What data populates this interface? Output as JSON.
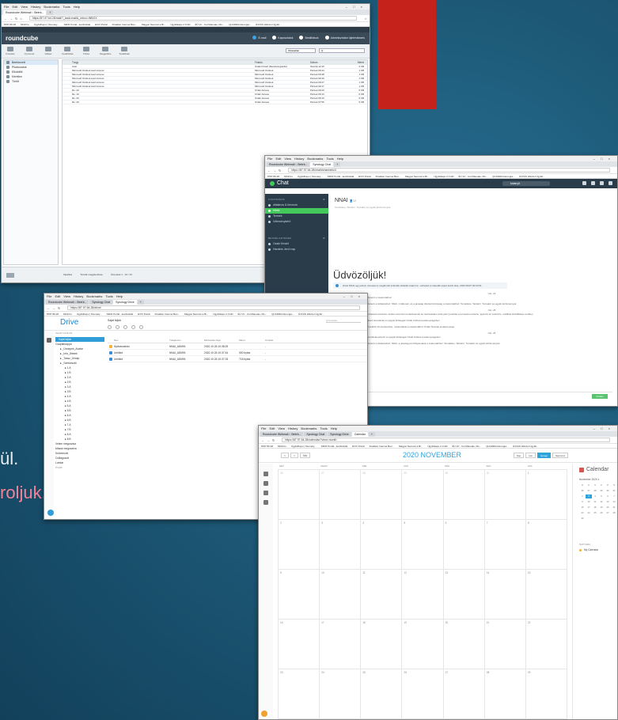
{
  "slide": {
    "line1": "ül.",
    "line2": "roljuk, ingyenes)"
  },
  "colors": {
    "accent_red": "#c4221b",
    "chat_green": "#44c85c",
    "drive_blue": "#2f9ed8",
    "calendar_blue": "#2fa3dc"
  },
  "common": {
    "menu": [
      "File",
      "Edit",
      "View",
      "History",
      "Bookmarks",
      "Tools",
      "Help"
    ],
    "bookmarks": [
      "8787.86.28",
      "MOZ.hu",
      "ÜgyfélKapu | Személy...",
      "SZDF Portál - kezdőoldal",
      "EVIV Portál",
      "Dnskiker Internet Ban...",
      "Magyar Nemzeti a Bi...",
      "Ügyfélkapu 2.0 HD",
      "ÉÜ Vír - Cel Manuale, Mo...",
      "QUADRA4 Energia...",
      "ÉJVÁS Hitiszet Ügyfél..."
    ]
  },
  "roundcube": {
    "tabs": [
      "Roundcube Webmail :: Beérk...",
      "+"
    ],
    "url": "https://87.97.64.28/mail/?_task=mail&_mbox=INBOX",
    "brand": "roundcube",
    "header_items": [
      "E-mail",
      "Kapcsolatok",
      "Beállítások",
      "Adminisztrátor kijelentkezés"
    ],
    "toolbar": [
      "Frissítés",
      "Új üzenet",
      "Válasz",
      "Továbbítás",
      "Törlés",
      "Megjelölés",
      "Továbbiak"
    ],
    "search_scope": "Olvasatlan",
    "search_placeholder": "Q",
    "folders": [
      "Beérkezett",
      "Piszkozatok",
      "Elküldött",
      "Kéretlen",
      "Törölt"
    ],
    "list_headers": {
      "subject": "Tárgy",
      "from": "Feladó",
      "date": "Dátum",
      "size": "Méret"
    },
    "rows": [
      {
        "subject": "Auto",
        "from": "Ozaki Kristóf (Rendszergazda)",
        "date": "Szerda 12:15",
        "size": "2 KB"
      },
      {
        "subject": "Microsoft Outlook teszt-üzenet",
        "from": "Microsoft Outlook",
        "date": "Péntek 09:44",
        "size": "1 KB"
      },
      {
        "subject": "Microsoft Outlook teszt-üzenet",
        "from": "Microsoft Outlook",
        "date": "Péntek 09:38",
        "size": "1 KB"
      },
      {
        "subject": "Microsoft Outlook teszt-üzenet",
        "from": "Microsoft Outlook",
        "date": "Péntek 09:30",
        "size": "1 KB"
      },
      {
        "subject": "Microsoft Outlook teszt-üzenet",
        "from": "Microsoft Outlook",
        "date": "Péntek 09:27",
        "size": "1 KB"
      },
      {
        "subject": "Microsoft Outlook teszt-üzenet",
        "from": "Microsoft Outlook",
        "date": "Péntek 09:17",
        "size": "1 KB"
      },
      {
        "subject": "Re: 20",
        "from": "Ozaki Jenese",
        "date": "Péntek 09:20",
        "size": "6 KB"
      },
      {
        "subject": "Re: 10",
        "from": "Ozaki Jenese",
        "date": "Péntek 09:13",
        "size": "6 KB"
      },
      {
        "subject": "Re: 20",
        "from": "Ozaki Jenese",
        "date": "Péntek 09:10",
        "size": "6 KB"
      },
      {
        "subject": "Re: 20",
        "from": "Ozaki Jenese",
        "date": "Péntek 07:56",
        "size": "6 KB"
      }
    ],
    "footer": [
      "Kijelölés",
      "Témák megjelenítése",
      "Üzenetek 1 - 10 / 10"
    ]
  },
  "chat": {
    "tabs": [
      "Roundcube Webmail :: Beérk...",
      "Synology Chat",
      "+"
    ],
    "url": "https://87.97.64.28/chat/#channels/4",
    "brand": "Chat",
    "search": "kalanyit",
    "sections": {
      "channels": "CSATORNÁK",
      "direct": "BESZÉLGETÉSEK"
    },
    "channels": [
      "általános & fórumok",
      "Hírek",
      "Termék",
      "Véleménykérő"
    ],
    "directs": [
      "Ozaki Kristóf",
      "Haralnis Jenő nap"
    ],
    "selected_channel": "Hírek",
    "channel_title": "NNAI",
    "channel_members": "13",
    "channel_sub": "Tematikus, Tartalmi, Témakör és egyéb közlemények",
    "welcome": "Üdvözöljük!",
    "notice": "Hírek NNAI egy jelzett, üzenetet a megkímélt szándék előtelélt csatorna - elolvasd a második napot kezdt ütés, 2020 09/27 00:10:51",
    "days": [
      "Okt. 23",
      "Okt. 28",
      "Okt. 28"
    ],
    "messages": [
      "allszenti a csatornákhoz",
      "allszenti a küldetéshez: NNAI, nzddenek, és a javaság döntséi közösség a csatornákhoz: Tematikus, Tartalmi, Témakör és egyéb közlemények",
      "a kötelező értesítés minden szerzési rendeléseinek és részvételére amik pénz jóváírás a termelési esztertu, igazolni az eszközre, szállítás kiszállítása rendben",
      "Állami beruházás a nyagoti költségek Ozaki Andréa tevékenységében",
      "a korábbi 19 szerkesztés, módosításai a csatornákhoz Ozaki Terések tevékenysége",
      "beruházás-érkező a nyagoti költségek Ozaki Andréa tevékenységében",
      "allszenti a küldetéshez: NNAI, a javaság pénzfolyamatok a csatornákhoz: Tematikus, Tartalmi, Témakör és egyéb közlemények"
    ],
    "send": "Küldés"
  },
  "drive": {
    "tabs": [
      "Roundcube Webmail :: Beérk...",
      "Synology Chat",
      "Synology Drive",
      "+"
    ],
    "url": "https://87.97.64.28/drive/",
    "brand": "Drive",
    "breadcrumb": "Saját fájlok",
    "search": "Q Keresés",
    "section": "SAJÁT FÁJLOK",
    "tree": [
      {
        "label": "Saját fájlok",
        "level": 0,
        "sel": true
      },
      {
        "label": "Csapatmappa",
        "level": 0
      },
      {
        "label": "_Ünnepek_Avatar",
        "level": 1
      },
      {
        "label": "_Info_Ülések",
        "level": 1
      },
      {
        "label": "_Tassz_Ünnép",
        "level": 1
      },
      {
        "label": "_Szerkesztő",
        "level": 1
      },
      {
        "label": "1.A",
        "level": 2
      },
      {
        "label": "1.B",
        "level": 2
      },
      {
        "label": "2.A",
        "level": 2
      },
      {
        "label": "2.B",
        "level": 2
      },
      {
        "label": "3.A",
        "level": 2
      },
      {
        "label": "3.B",
        "level": 2
      },
      {
        "label": "4.A",
        "level": 2
      },
      {
        "label": "4.B",
        "level": 2
      },
      {
        "label": "5.A",
        "level": 2
      },
      {
        "label": "5.B",
        "level": 2
      },
      {
        "label": "6.A",
        "level": 2
      },
      {
        "label": "6.B",
        "level": 2
      },
      {
        "label": "7.A",
        "level": 2
      },
      {
        "label": "7.B",
        "level": 2
      },
      {
        "label": "8.A",
        "level": 2
      },
      {
        "label": "8.B",
        "level": 2
      },
      {
        "label": "Velem megosztva",
        "level": 0
      },
      {
        "label": "Mások megosztva",
        "level": 0
      },
      {
        "label": "Kedvencek",
        "level": 0
      },
      {
        "label": "Csillagozott",
        "level": 0
      },
      {
        "label": "Lomtár",
        "level": 0
      }
    ],
    "quota": "Kvóta",
    "headers": {
      "name": "Név",
      "owner": "Tulajdonos",
      "modified": "Módosítás ideje",
      "size": "Méret",
      "desc": "Címkék"
    },
    "rows": [
      {
        "name": "Nyilvánosfoto",
        "owner": "NNAI_ADMIN",
        "modified": "2020.10.26 10:38:29",
        "size": "",
        "desc": "-",
        "folder": true
      },
      {
        "name": "Untitled",
        "owner": "NNAI_ADMIN",
        "modified": "2020.10.26 10:37:44",
        "size": "500 bytes",
        "desc": "-",
        "folder": false
      },
      {
        "name": "Untitled",
        "owner": "NNAI_ADMIN",
        "modified": "2020.10.26 10:37:33",
        "size": "718 bytes",
        "desc": "-",
        "folder": false
      }
    ]
  },
  "calendar": {
    "tabs": [
      "Roundcube Webmail :: Beérk...",
      "Synology Chat",
      "Synology Drive",
      "Calendar",
      "+"
    ],
    "url": "https://87.97.64.28/calendar/?view=month",
    "title": "2020 NOVEMBER",
    "nav": [
      "<",
      ">",
      "Ma"
    ],
    "views": [
      "Nap",
      "Hét",
      "Hónap",
      "Napirend"
    ],
    "active_view": "Hónap",
    "dow": [
      "HÉT",
      "KEDD",
      "SZE",
      "CSÜ",
      "PÉN",
      "SZO",
      "VAS"
    ],
    "weeks": [
      [
        "26",
        "27",
        "28",
        "29",
        "30",
        "31",
        "1"
      ],
      [
        "2",
        "3",
        "4",
        "5",
        "6",
        "7",
        "8"
      ],
      [
        "9",
        "10",
        "11",
        "12",
        "13",
        "14",
        "15"
      ],
      [
        "16",
        "17",
        "18",
        "19",
        "20",
        "21",
        "22"
      ],
      [
        "23",
        "24",
        "25",
        "26",
        "27",
        "28",
        "29"
      ]
    ],
    "side_title": "Calendar",
    "mini_month": "November 2020 ▾",
    "mini_dow": [
      "H",
      "K",
      "S",
      "C",
      "P",
      "S",
      "V"
    ],
    "mini_days": [
      "26",
      "27",
      "28",
      "29",
      "30",
      "31",
      "1",
      "2",
      "3",
      "4",
      "5",
      "6",
      "7",
      "8",
      "9",
      "10",
      "11",
      "12",
      "13",
      "14",
      "15",
      "16",
      "17",
      "18",
      "19",
      "20",
      "21",
      "22",
      "23",
      "24",
      "25",
      "26",
      "27",
      "28",
      "29",
      "30"
    ],
    "today": "3",
    "cal_label": "NAPTÁRA",
    "cal_item": "My Calendar"
  }
}
